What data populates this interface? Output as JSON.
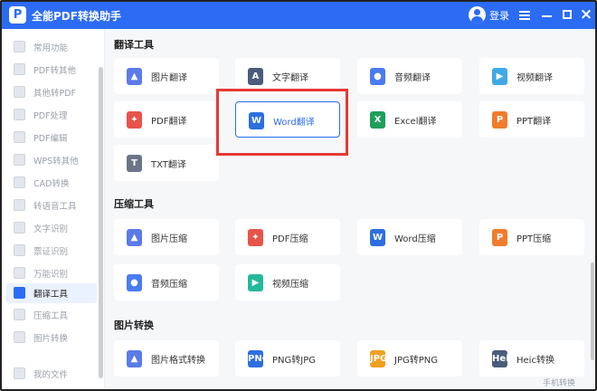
{
  "app": {
    "title": "全能PDF转换助手",
    "login": "登录",
    "logo_letter": "P"
  },
  "colors": {
    "brand": "#2c6cf5",
    "highlight": "#e53935"
  },
  "sidebar": {
    "items": [
      {
        "label": "常用功能"
      },
      {
        "label": "PDF转其他"
      },
      {
        "label": "其他转PDF"
      },
      {
        "label": "PDF处理"
      },
      {
        "label": "PDF编辑"
      },
      {
        "label": "WPS转其他"
      },
      {
        "label": "CAD转换"
      },
      {
        "label": "转语音工具"
      },
      {
        "label": "文字识别"
      },
      {
        "label": "票证识别"
      },
      {
        "label": "万能识别"
      },
      {
        "label": "翻译工具",
        "active": true
      },
      {
        "label": "压缩工具"
      },
      {
        "label": "图片转换"
      },
      {
        "label": "我的文件"
      }
    ]
  },
  "sections": {
    "translate": {
      "title": "翻译工具",
      "tiles": [
        {
          "label": "图片翻译",
          "icon": "image-translate-icon"
        },
        {
          "label": "文字翻译",
          "icon": "text-translate-icon",
          "glyph": "A"
        },
        {
          "label": "音频翻译",
          "icon": "audio-translate-icon"
        },
        {
          "label": "视频翻译",
          "icon": "video-translate-icon"
        },
        {
          "label": "PDF翻译",
          "icon": "pdf-translate-icon"
        },
        {
          "label": "Word翻译",
          "icon": "word-translate-icon",
          "glyph": "W",
          "selected": true
        },
        {
          "label": "Excel翻译",
          "icon": "excel-translate-icon",
          "glyph": "X"
        },
        {
          "label": "PPT翻译",
          "icon": "ppt-translate-icon",
          "glyph": "P"
        },
        {
          "label": "TXT翻译",
          "icon": "txt-translate-icon",
          "glyph": "T"
        }
      ]
    },
    "compress": {
      "title": "压缩工具",
      "tiles": [
        {
          "label": "图片压缩",
          "icon": "image-compress-icon"
        },
        {
          "label": "PDF压缩",
          "icon": "pdf-compress-icon"
        },
        {
          "label": "Word压缩",
          "icon": "word-compress-icon",
          "glyph": "W"
        },
        {
          "label": "PPT压缩",
          "icon": "ppt-compress-icon",
          "glyph": "P"
        },
        {
          "label": "音频压缩",
          "icon": "audio-compress-icon"
        },
        {
          "label": "视频压缩",
          "icon": "video-compress-icon"
        }
      ]
    },
    "image": {
      "title": "图片转换",
      "tiles": [
        {
          "label": "图片格式转换",
          "icon": "image-format-icon"
        },
        {
          "label": "PNG转JPG",
          "icon": "png-to-jpg-icon",
          "glyph": "PNG"
        },
        {
          "label": "JPG转PNG",
          "icon": "jpg-to-png-icon",
          "glyph": "JPG"
        },
        {
          "label": "Heic转换",
          "icon": "heic-convert-icon",
          "glyph": "Heic"
        }
      ]
    }
  },
  "footer": {
    "mobile": "手机转换"
  }
}
